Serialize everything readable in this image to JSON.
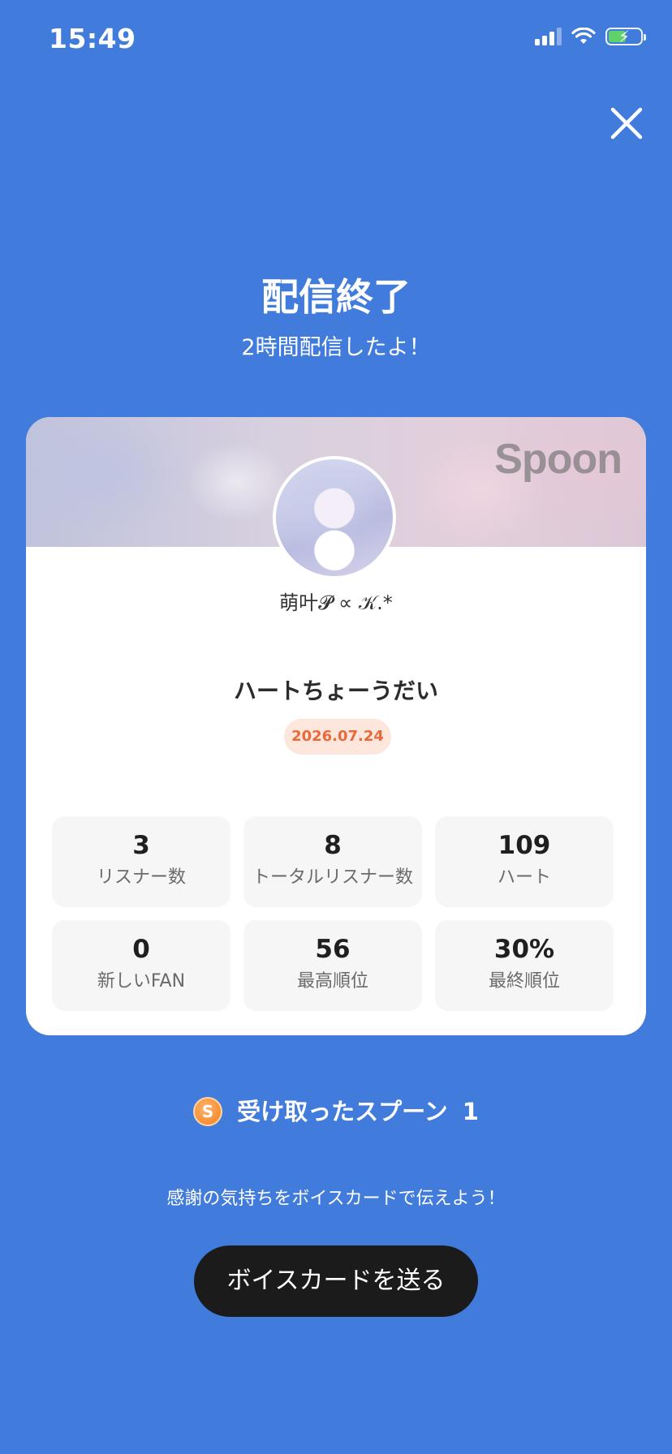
{
  "status_bar": {
    "time": "15:49",
    "battery_level": 0.55
  },
  "header": {
    "title": "配信終了",
    "subtitle": "2時間配信したよ！"
  },
  "card": {
    "banner_logo": "Spoon",
    "dj_name": "萌叶𝓟 ∝ 𝒦.*",
    "live_title": "ハートちょーうだい",
    "date": "2026.07.24",
    "stats": [
      {
        "value": "3",
        "label": "リスナー数"
      },
      {
        "value": "8",
        "label": "トータルリスナー数"
      },
      {
        "value": "109",
        "label": "ハート"
      },
      {
        "value": "0",
        "label": "新しいFAN"
      },
      {
        "value": "56",
        "label": "最高順位"
      },
      {
        "value": "30%",
        "label": "最終順位"
      }
    ]
  },
  "spoons": {
    "icon_letter": "S",
    "label": "受け取ったスプーン",
    "count": "1"
  },
  "footer": {
    "thanks_text": "感謝の気持ちをボイスカードで伝えよう！",
    "button_label": "ボイスカードを送る"
  },
  "colors": {
    "background": "#417bdb",
    "accent_date": "#e8693a",
    "button": "#1b1b1b"
  }
}
